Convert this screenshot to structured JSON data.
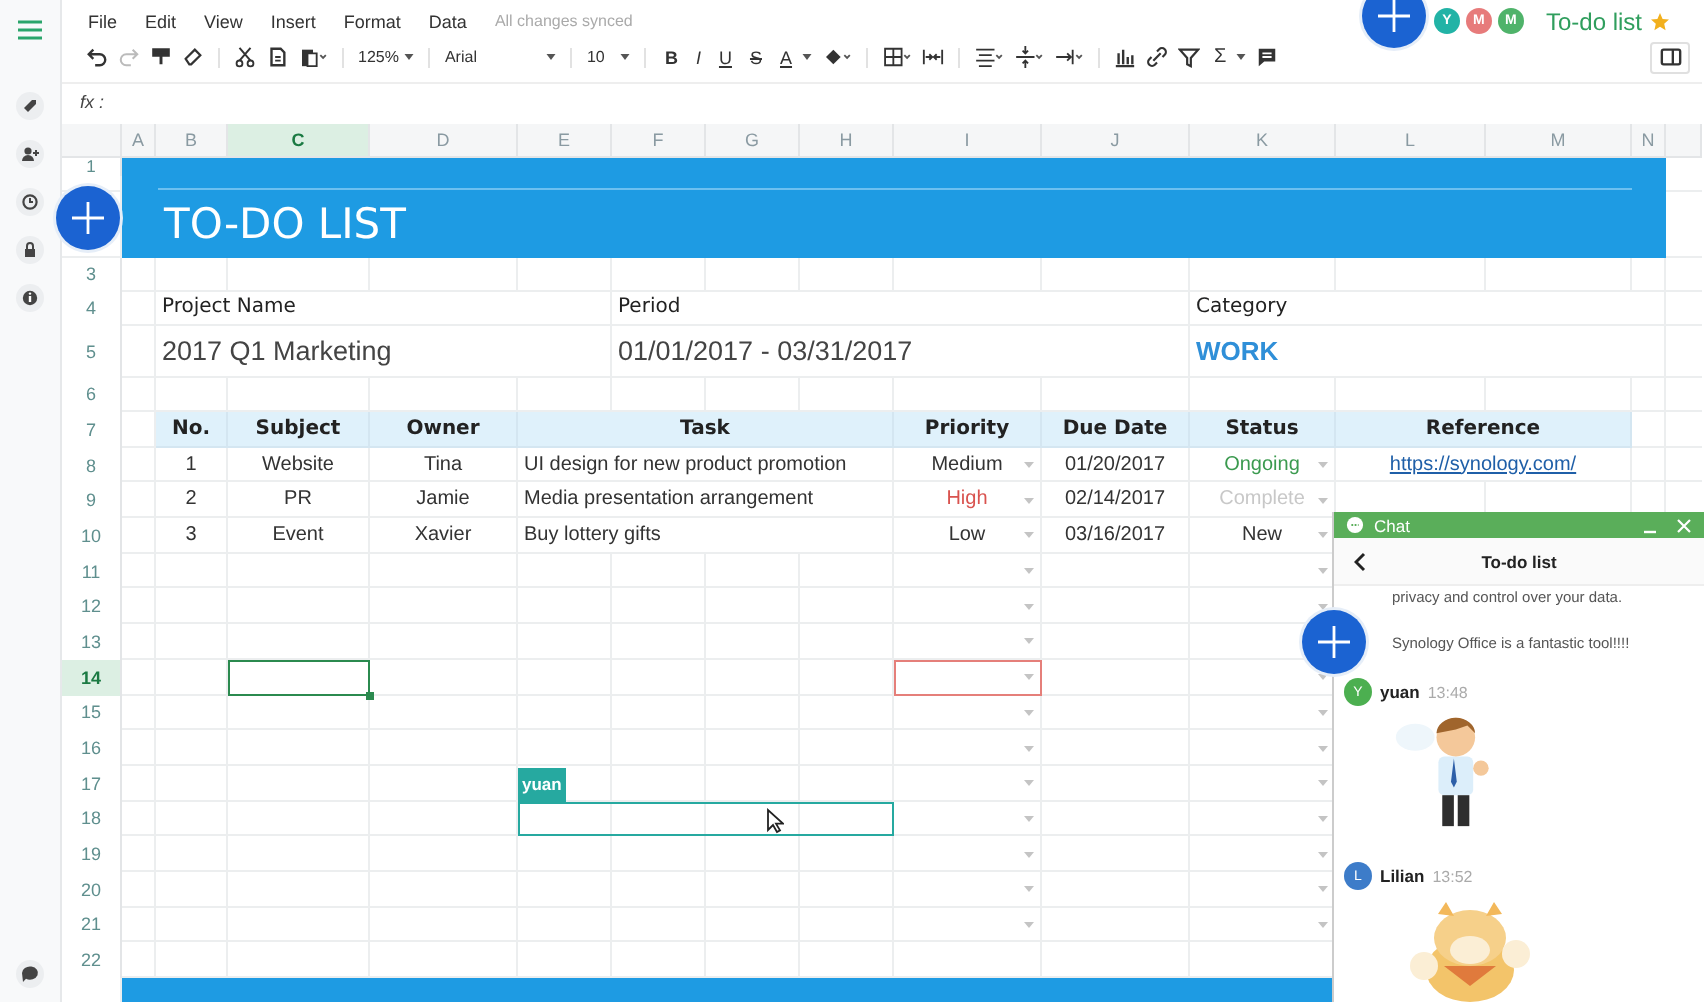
{
  "menu": [
    "File",
    "Edit",
    "View",
    "Insert",
    "Format",
    "Data"
  ],
  "sync_status": "All changes synced",
  "document": {
    "title": "To-do list",
    "starred": true
  },
  "collaborators": [
    {
      "initial": "Y",
      "color": "#22b3a6"
    },
    {
      "initial": "M",
      "color": "#e77b7b"
    },
    {
      "initial": "M",
      "color": "#4fb36a"
    }
  ],
  "toolbar": {
    "zoom": "125%",
    "font": "Arial",
    "font_size": "10",
    "format_buttons": [
      "B",
      "I",
      "U",
      "S",
      "A"
    ],
    "sum_button": "Σ"
  },
  "formula_bar": {
    "label": "fx :"
  },
  "sheet": {
    "column_headers": [
      {
        "label": "A",
        "selected": false
      },
      {
        "label": "B",
        "selected": false
      },
      {
        "label": "C",
        "selected": true
      },
      {
        "label": "D",
        "selected": false
      },
      {
        "label": "E",
        "selected": false
      },
      {
        "label": "F",
        "selected": false
      },
      {
        "label": "G",
        "selected": false
      },
      {
        "label": "H",
        "selected": false
      },
      {
        "label": "I",
        "selected": false
      },
      {
        "label": "J",
        "selected": false
      },
      {
        "label": "K",
        "selected": false
      },
      {
        "label": "L",
        "selected": false
      },
      {
        "label": "M",
        "selected": false
      },
      {
        "label": "N",
        "selected": false
      }
    ],
    "row_headers": [
      {
        "label": "1",
        "selected": false
      },
      {
        "label": "3",
        "selected": false
      },
      {
        "label": "4",
        "selected": false
      },
      {
        "label": "5",
        "selected": false
      },
      {
        "label": "6",
        "selected": false
      },
      {
        "label": "7",
        "selected": false
      },
      {
        "label": "8",
        "selected": false
      },
      {
        "label": "9",
        "selected": false
      },
      {
        "label": "10",
        "selected": false
      },
      {
        "label": "11",
        "selected": false
      },
      {
        "label": "12",
        "selected": false
      },
      {
        "label": "13",
        "selected": false
      },
      {
        "label": "14",
        "selected": true
      },
      {
        "label": "15",
        "selected": false
      },
      {
        "label": "16",
        "selected": false
      },
      {
        "label": "17",
        "selected": false
      },
      {
        "label": "18",
        "selected": false
      },
      {
        "label": "19",
        "selected": false
      },
      {
        "label": "20",
        "selected": false
      },
      {
        "label": "21",
        "selected": false
      },
      {
        "label": "22",
        "selected": false
      }
    ],
    "banner_title": "TO-DO LIST",
    "project_info": [
      {
        "label": "Project Name",
        "value": "2017 Q1 Marketing",
        "kind": "plain"
      },
      {
        "label": "Period",
        "value": "01/01/2017 - 03/31/2017",
        "kind": "plain"
      },
      {
        "label": "Category",
        "value": "WORK",
        "kind": "emphasis"
      }
    ],
    "table": {
      "columns": [
        "No.",
        "Subject",
        "Owner",
        "Task",
        "Priority",
        "Due Date",
        "Status",
        "Reference"
      ],
      "rows": [
        {
          "no": "1",
          "subject": "Website",
          "owner": "Tina",
          "task": "UI design for new product promotion",
          "priority": {
            "text": "Medium",
            "color": "#333333"
          },
          "due": "01/20/2017",
          "status": {
            "text": "Ongoing",
            "color": "#3b9a4f"
          },
          "reference": "https://synology.com/"
        },
        {
          "no": "2",
          "subject": "PR",
          "owner": "Jamie",
          "task": "Media presentation arrangement",
          "priority": {
            "text": "High",
            "color": "#d9534f"
          },
          "due": "02/14/2017",
          "status": {
            "text": "Complete",
            "color": "#c8c8c8"
          }
        },
        {
          "no": "3",
          "subject": "Event",
          "owner": "Xavier",
          "task": "Buy lottery gifts",
          "priority": {
            "text": "Low",
            "color": "#333333"
          },
          "due": "03/16/2017",
          "status": {
            "text": "New",
            "color": "#333333"
          }
        }
      ]
    },
    "collaborator_cursors": [
      {
        "color": "#e57f7a"
      },
      {
        "name": "yuan",
        "color": "#26a9a0"
      }
    ]
  },
  "chat": {
    "title": "Chat",
    "conversation": "To-do list",
    "messages": [
      {
        "kind": "text",
        "text": "privacy and control over your data."
      },
      {
        "kind": "text",
        "text": "Synology Office is a fantastic tool!!!!"
      },
      {
        "kind": "sticker",
        "author": "yuan",
        "initial": "Y",
        "color": "#4caf50",
        "time": "13:48"
      },
      {
        "kind": "sticker",
        "author": "Lilian",
        "initial": "L",
        "color": "#3d7cc9",
        "time": "13:52"
      }
    ]
  }
}
